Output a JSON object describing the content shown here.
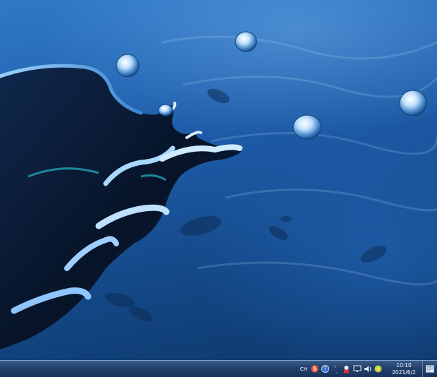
{
  "desktop": {
    "wallpaper": "water-splash-wallpaper",
    "colors": {
      "water_light": "#2f79c7",
      "water_dark": "#0d3668",
      "splash_dark": "#0a1a33",
      "highlight": "#cfe8ff",
      "accent": "#27b7c7"
    }
  },
  "taskbar": {
    "tray": {
      "language": "CH",
      "icons": [
        "sogou-input-icon",
        "help-icon",
        "input-mode-icon",
        "security-app-icon",
        "network-icon",
        "volume-icon",
        "status-app-icon",
        "show-desktop-icon"
      ]
    },
    "clock": {
      "time": "10:10",
      "date": "2021/6/2"
    }
  }
}
